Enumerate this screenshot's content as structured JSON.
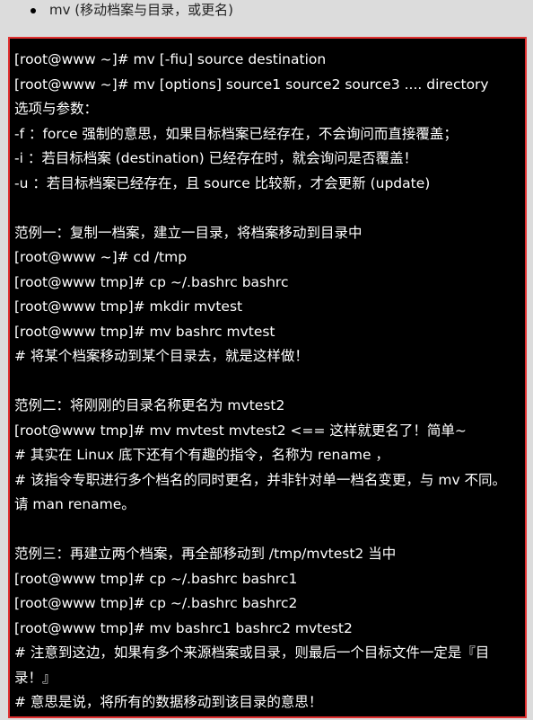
{
  "bullet": {
    "text": "mv (移动档案与目录，或更名)"
  },
  "code_lines": [
    "[root@www ~]# mv [-fiu] source destination",
    "[root@www ~]# mv [options] source1 source2 source3 .... directory",
    "选项与参数：",
    "-f ：force 强制的意思，如果目标档案已经存在，不会询问而直接覆盖；",
    "-i ：若目标档案 (destination) 已经存在时，就会询问是否覆盖！",
    "-u ：若目标档案已经存在，且 source 比较新，才会更新 (update)",
    "",
    "范例一：复制一档案，建立一目录，将档案移动到目录中",
    "[root@www ~]# cd /tmp",
    "[root@www tmp]# cp ~/.bashrc bashrc",
    "[root@www tmp]# mkdir mvtest",
    "[root@www tmp]# mv bashrc mvtest",
    "# 将某个档案移动到某个目录去，就是这样做！",
    "",
    "范例二：将刚刚的目录名称更名为 mvtest2",
    "[root@www tmp]# mv mvtest mvtest2 <== 这样就更名了！简单~",
    "# 其实在 Linux 底下还有个有趣的指令，名称为 rename ，",
    "# 该指令专职进行多个档名的同时更名，并非针对单一档名变更，与 mv 不同。",
    "请 man rename。",
    "",
    "范例三：再建立两个档案，再全部移动到 /tmp/mvtest2 当中",
    "[root@www tmp]# cp ~/.bashrc bashrc1",
    "[root@www tmp]# cp ~/.bashrc bashrc2",
    "[root@www tmp]# mv bashrc1 bashrc2 mvtest2",
    "# 注意到这边，如果有多个来源档案或目录，则最后一个目标文件一定是『目",
    "录！』",
    "# 意思是说，将所有的数据移动到该目录的意思！"
  ]
}
